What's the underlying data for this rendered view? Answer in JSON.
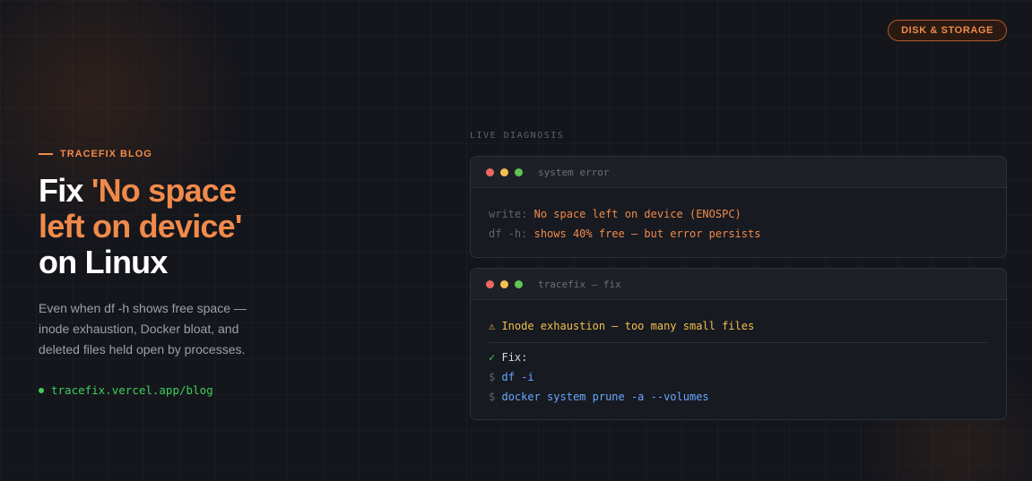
{
  "badge": {
    "label": "DISK & STORAGE"
  },
  "hero": {
    "eyebrow": "TRACEFIX BLOG",
    "title_prefix": "Fix ",
    "title_highlight_line1": "'No space",
    "title_highlight_line2": "left on device'",
    "title_suffix": "on Linux",
    "description": "Even when df -h shows free space — inode exhaustion, Docker bloat, and deleted files held open by processes.",
    "url": "tracefix.vercel.app/blog"
  },
  "section_label": "LIVE DIAGNOSIS",
  "terminal_error": {
    "title": "system error",
    "lines": [
      {
        "prefix": "write:",
        "text": "No space left on device (ENOSPC)"
      },
      {
        "prefix": "df -h:",
        "text": "shows 40% free — but error persists"
      }
    ]
  },
  "terminal_fix": {
    "title": "tracefix — fix",
    "warning": "⚠ Inode exhaustion — too many small files",
    "fix_check": "✓",
    "fix_label": "Fix:",
    "prompt": "$",
    "commands": [
      "df -i",
      "docker system prune -a --volumes"
    ]
  },
  "colors": {
    "accent": "#f08a4b",
    "success": "#3ecf5a",
    "command": "#6aa7ff",
    "warning": "#f4bf4f",
    "background": "#14161c"
  }
}
